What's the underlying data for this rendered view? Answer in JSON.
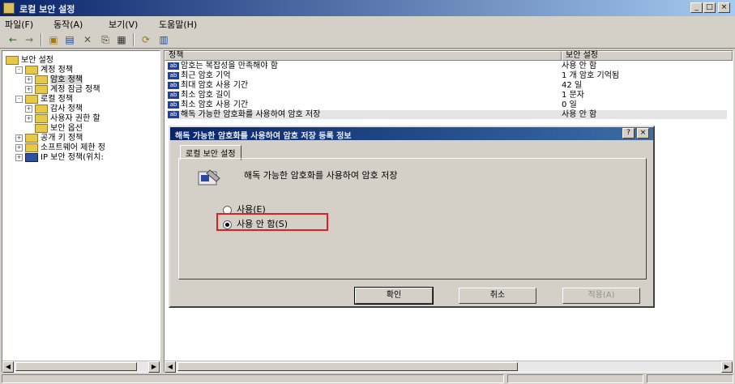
{
  "window": {
    "title": "로컬 보안 설정"
  },
  "menu": [
    "파일(F)",
    "동작(A)",
    "보기(V)",
    "도움말(H)"
  ],
  "toolbar": {
    "icons": [
      "back-icon",
      "forward-icon",
      "up-icon",
      "tree-icon",
      "delete-icon",
      "export-icon",
      "properties-icon",
      "refresh-icon",
      "help-icon"
    ]
  },
  "tree": [
    {
      "label": "보안 설정",
      "level": 0,
      "expander": ""
    },
    {
      "label": "계정 정책",
      "level": 1,
      "expander": "-"
    },
    {
      "label": "암호 정책",
      "level": 2,
      "expander": "+",
      "selected": true
    },
    {
      "label": "계정 잠금 정책",
      "level": 2,
      "expander": "+"
    },
    {
      "label": "로컬 정책",
      "level": 1,
      "expander": "-"
    },
    {
      "label": "감사 정책",
      "level": 2,
      "expander": "+"
    },
    {
      "label": "사용자 권한 할",
      "level": 2,
      "expander": "+"
    },
    {
      "label": "보안 옵션",
      "level": 2,
      "expander": ""
    },
    {
      "label": "공개 키 정책",
      "level": 1,
      "expander": "+"
    },
    {
      "label": "소프트웨어 제한 정",
      "level": 1,
      "expander": "+"
    },
    {
      "label": "IP 보안 정책(위치:",
      "level": 1,
      "expander": "+"
    }
  ],
  "list": {
    "headers": [
      "정책",
      "보안 설정"
    ],
    "rows": [
      {
        "policy": "암호는 복잡성을 만족해야 함",
        "setting": "사용 안 함"
      },
      {
        "policy": "최근 암호 기억",
        "setting": "1 개 암호 기억됨"
      },
      {
        "policy": "최대 암호 사용 기간",
        "setting": "42 일"
      },
      {
        "policy": "최소 암호 길이",
        "setting": "1 문자"
      },
      {
        "policy": "최소 암호 사용 기간",
        "setting": "0 일"
      },
      {
        "policy": "해독 가능한 암호화를 사용하여 암호 저장",
        "setting": "사용 안 함",
        "highlighted": true
      }
    ]
  },
  "dialog": {
    "title": "해독 가능한 암호화를 사용하여 암호 저장 등록 정보",
    "tab": "로컬 보안 설정",
    "description": "해독 가능한 암호화를 사용하여 암호 저장",
    "radio_enable": "사용(E)",
    "radio_disable": "사용 안 함(S)",
    "selected": "disable",
    "ok": "확인",
    "cancel": "취소",
    "apply": "적용(A)",
    "help_btn": "?",
    "close_btn": "×"
  },
  "colors": {
    "title_bar": "#0a246a",
    "highlight_box": "#e02020"
  }
}
